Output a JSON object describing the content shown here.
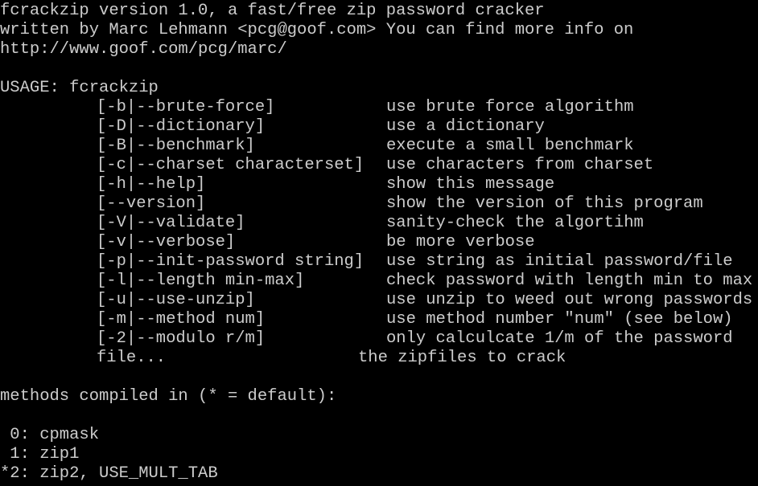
{
  "header": {
    "line1": "fcrackzip version 1.0, a fast/free zip password cracker",
    "line2": "written by Marc Lehmann <pcg@goof.com> You can find more info on",
    "line3": "http://www.goof.com/pcg/marc/"
  },
  "usage": {
    "title": "USAGE: fcrackzip",
    "options": [
      {
        "flag": "[-b|--brute-force]",
        "desc": "use brute force algorithm"
      },
      {
        "flag": "[-D|--dictionary]",
        "desc": "use a dictionary"
      },
      {
        "flag": "[-B|--benchmark]",
        "desc": "execute a small benchmark"
      },
      {
        "flag": "[-c|--charset characterset]",
        "desc": "use characters from charset"
      },
      {
        "flag": "[-h|--help]",
        "desc": "show this message"
      },
      {
        "flag": "[--version]",
        "desc": "show the version of this program"
      },
      {
        "flag": "[-V|--validate]",
        "desc": "sanity-check the algortihm"
      },
      {
        "flag": "[-v|--verbose]",
        "desc": "be more verbose"
      },
      {
        "flag": "[-p|--init-password string]",
        "desc": "use string as initial password/file"
      },
      {
        "flag": "[-l|--length min-max]",
        "desc": "check password with length min to max"
      },
      {
        "flag": "[-u|--use-unzip]",
        "desc": "use unzip to weed out wrong passwords"
      },
      {
        "flag": "[-m|--method num]",
        "desc": "use method number \"num\" (see below)"
      },
      {
        "flag": "[-2|--modulo r/m]",
        "desc": "only calculcate 1/m of the password"
      }
    ],
    "file_arg": "file...",
    "file_desc": "the zipfiles to crack"
  },
  "methods": {
    "title": "methods compiled in (* = default):",
    "items": [
      " 0: cpmask",
      " 1: zip1",
      "*2: zip2, USE_MULT_TAB"
    ]
  },
  "colors": {
    "background": "#000000",
    "foreground": "#cccccc"
  }
}
